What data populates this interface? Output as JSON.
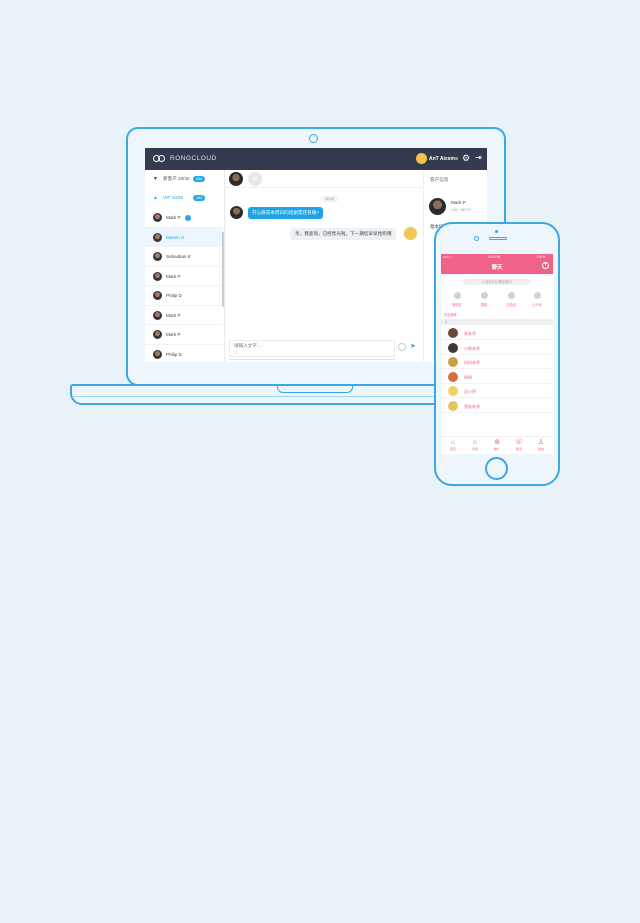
{
  "laptop": {
    "brand": "RONGCLOUD",
    "user_name": "AnT Aixem",
    "sidebar": {
      "group1": {
        "name": "新客户 20/30",
        "badge": "284"
      },
      "group2": {
        "name": "VIP 10/20",
        "badge": "284"
      },
      "contacts": [
        {
          "name": "Mark P",
          "badge": true
        },
        {
          "name": "Marvin G",
          "active": true
        },
        {
          "name": "Sebastian K"
        },
        {
          "name": "Mark P"
        },
        {
          "name": "Philip D"
        },
        {
          "name": "Mark P"
        },
        {
          "name": "Mark P"
        },
        {
          "name": "Philip D"
        }
      ]
    },
    "chat": {
      "time": "16:30",
      "incoming": "开心麻花本周日的话剧票还有嘛?",
      "outgoing": "亲，我查询，已经售光啦，下一期您早早抢购哦",
      "input_placeholder": "请输入文字..."
    },
    "info": {
      "title": "客户信息",
      "name": "Mark P",
      "uid": "UID：88737",
      "section": "基本信息"
    }
  },
  "phone": {
    "status_left": "••••• ≈",
    "status_time": "4:24 PM",
    "status_battery": "100%",
    "title": "聊天",
    "search_placeholder": "Q 搜索好友/群组/聊天",
    "quick": [
      "新朋友",
      "群组",
      "讨论组",
      "公众号"
    ],
    "tag": "好友推荐",
    "section_letter": "A",
    "friends": [
      {
        "name": "朱老师",
        "color": "#6b4a3a"
      },
      {
        "name": "小熊老师",
        "color": "#3e3a33"
      },
      {
        "name": "妈妈老师",
        "color": "#c9a040"
      },
      {
        "name": "明明",
        "color": "#d4713a"
      },
      {
        "name": "吴小明",
        "color": "#f1d064"
      },
      {
        "name": "黑板老师",
        "color": "#e7c25a"
      }
    ],
    "tabs": [
      {
        "icon": "⌂",
        "label": "首页"
      },
      {
        "icon": "☺",
        "label": "表情"
      },
      {
        "icon": "⊕",
        "label": "推广"
      },
      {
        "icon": "☏",
        "label": "聊天"
      },
      {
        "icon": "♙",
        "label": "我的"
      }
    ]
  }
}
